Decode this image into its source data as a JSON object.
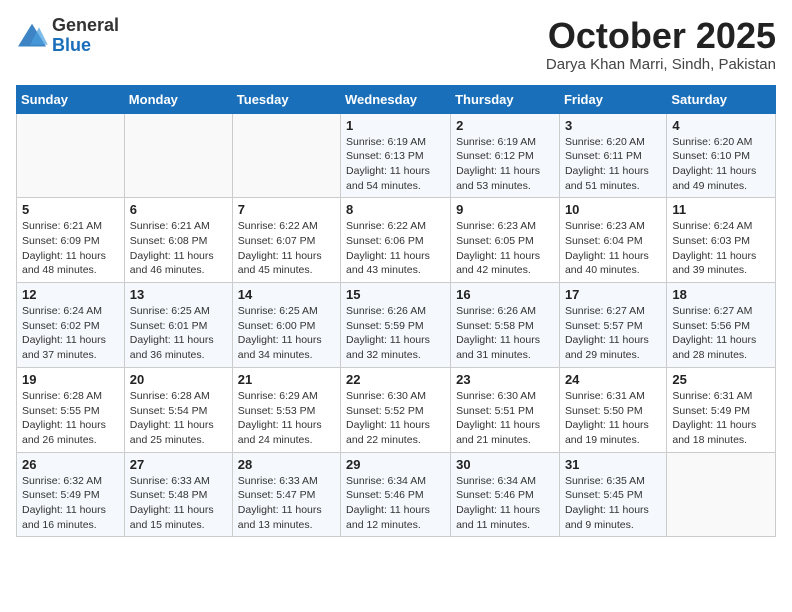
{
  "header": {
    "logo_line1": "General",
    "logo_line2": "Blue",
    "month_title": "October 2025",
    "location": "Darya Khan Marri, Sindh, Pakistan"
  },
  "weekdays": [
    "Sunday",
    "Monday",
    "Tuesday",
    "Wednesday",
    "Thursday",
    "Friday",
    "Saturday"
  ],
  "weeks": [
    [
      {
        "day": "",
        "info": ""
      },
      {
        "day": "",
        "info": ""
      },
      {
        "day": "",
        "info": ""
      },
      {
        "day": "1",
        "info": "Sunrise: 6:19 AM\nSunset: 6:13 PM\nDaylight: 11 hours\nand 54 minutes."
      },
      {
        "day": "2",
        "info": "Sunrise: 6:19 AM\nSunset: 6:12 PM\nDaylight: 11 hours\nand 53 minutes."
      },
      {
        "day": "3",
        "info": "Sunrise: 6:20 AM\nSunset: 6:11 PM\nDaylight: 11 hours\nand 51 minutes."
      },
      {
        "day": "4",
        "info": "Sunrise: 6:20 AM\nSunset: 6:10 PM\nDaylight: 11 hours\nand 49 minutes."
      }
    ],
    [
      {
        "day": "5",
        "info": "Sunrise: 6:21 AM\nSunset: 6:09 PM\nDaylight: 11 hours\nand 48 minutes."
      },
      {
        "day": "6",
        "info": "Sunrise: 6:21 AM\nSunset: 6:08 PM\nDaylight: 11 hours\nand 46 minutes."
      },
      {
        "day": "7",
        "info": "Sunrise: 6:22 AM\nSunset: 6:07 PM\nDaylight: 11 hours\nand 45 minutes."
      },
      {
        "day": "8",
        "info": "Sunrise: 6:22 AM\nSunset: 6:06 PM\nDaylight: 11 hours\nand 43 minutes."
      },
      {
        "day": "9",
        "info": "Sunrise: 6:23 AM\nSunset: 6:05 PM\nDaylight: 11 hours\nand 42 minutes."
      },
      {
        "day": "10",
        "info": "Sunrise: 6:23 AM\nSunset: 6:04 PM\nDaylight: 11 hours\nand 40 minutes."
      },
      {
        "day": "11",
        "info": "Sunrise: 6:24 AM\nSunset: 6:03 PM\nDaylight: 11 hours\nand 39 minutes."
      }
    ],
    [
      {
        "day": "12",
        "info": "Sunrise: 6:24 AM\nSunset: 6:02 PM\nDaylight: 11 hours\nand 37 minutes."
      },
      {
        "day": "13",
        "info": "Sunrise: 6:25 AM\nSunset: 6:01 PM\nDaylight: 11 hours\nand 36 minutes."
      },
      {
        "day": "14",
        "info": "Sunrise: 6:25 AM\nSunset: 6:00 PM\nDaylight: 11 hours\nand 34 minutes."
      },
      {
        "day": "15",
        "info": "Sunrise: 6:26 AM\nSunset: 5:59 PM\nDaylight: 11 hours\nand 32 minutes."
      },
      {
        "day": "16",
        "info": "Sunrise: 6:26 AM\nSunset: 5:58 PM\nDaylight: 11 hours\nand 31 minutes."
      },
      {
        "day": "17",
        "info": "Sunrise: 6:27 AM\nSunset: 5:57 PM\nDaylight: 11 hours\nand 29 minutes."
      },
      {
        "day": "18",
        "info": "Sunrise: 6:27 AM\nSunset: 5:56 PM\nDaylight: 11 hours\nand 28 minutes."
      }
    ],
    [
      {
        "day": "19",
        "info": "Sunrise: 6:28 AM\nSunset: 5:55 PM\nDaylight: 11 hours\nand 26 minutes."
      },
      {
        "day": "20",
        "info": "Sunrise: 6:28 AM\nSunset: 5:54 PM\nDaylight: 11 hours\nand 25 minutes."
      },
      {
        "day": "21",
        "info": "Sunrise: 6:29 AM\nSunset: 5:53 PM\nDaylight: 11 hours\nand 24 minutes."
      },
      {
        "day": "22",
        "info": "Sunrise: 6:30 AM\nSunset: 5:52 PM\nDaylight: 11 hours\nand 22 minutes."
      },
      {
        "day": "23",
        "info": "Sunrise: 6:30 AM\nSunset: 5:51 PM\nDaylight: 11 hours\nand 21 minutes."
      },
      {
        "day": "24",
        "info": "Sunrise: 6:31 AM\nSunset: 5:50 PM\nDaylight: 11 hours\nand 19 minutes."
      },
      {
        "day": "25",
        "info": "Sunrise: 6:31 AM\nSunset: 5:49 PM\nDaylight: 11 hours\nand 18 minutes."
      }
    ],
    [
      {
        "day": "26",
        "info": "Sunrise: 6:32 AM\nSunset: 5:49 PM\nDaylight: 11 hours\nand 16 minutes."
      },
      {
        "day": "27",
        "info": "Sunrise: 6:33 AM\nSunset: 5:48 PM\nDaylight: 11 hours\nand 15 minutes."
      },
      {
        "day": "28",
        "info": "Sunrise: 6:33 AM\nSunset: 5:47 PM\nDaylight: 11 hours\nand 13 minutes."
      },
      {
        "day": "29",
        "info": "Sunrise: 6:34 AM\nSunset: 5:46 PM\nDaylight: 11 hours\nand 12 minutes."
      },
      {
        "day": "30",
        "info": "Sunrise: 6:34 AM\nSunset: 5:46 PM\nDaylight: 11 hours\nand 11 minutes."
      },
      {
        "day": "31",
        "info": "Sunrise: 6:35 AM\nSunset: 5:45 PM\nDaylight: 11 hours\nand 9 minutes."
      },
      {
        "day": "",
        "info": ""
      }
    ]
  ]
}
